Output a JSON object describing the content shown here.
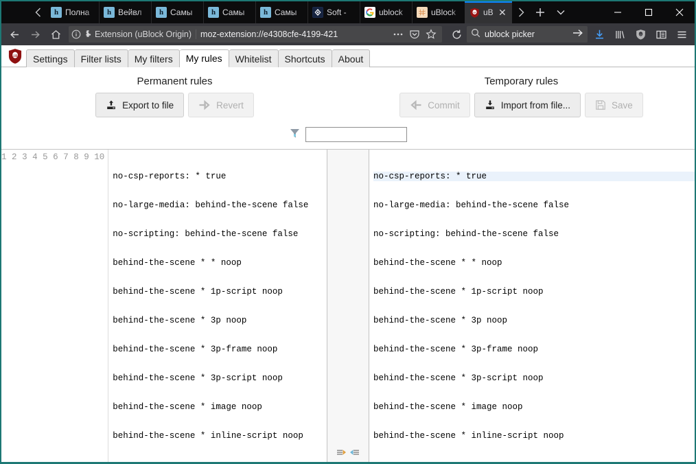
{
  "browser": {
    "tabs": [
      {
        "label": "Полна",
        "favicon": "h-icon"
      },
      {
        "label": "Вейвл",
        "favicon": "h-icon"
      },
      {
        "label": "Самы",
        "favicon": "h-icon"
      },
      {
        "label": "Самы",
        "favicon": "h-icon"
      },
      {
        "label": "Самы",
        "favicon": "h-icon"
      },
      {
        "label": "Soft - ",
        "favicon": "soft-icon"
      },
      {
        "label": "ublock",
        "favicon": "google-icon"
      },
      {
        "label": "uBlock",
        "favicon": "ublock-ball-icon"
      },
      {
        "label": "uB",
        "favicon": "ublock-shield-icon",
        "active": true
      }
    ],
    "new_tab_label": "+",
    "tab_list_menu_label": "⌄",
    "scroll_back_label": "‹",
    "scroll_forward_label": "›",
    "window_controls": {
      "minimize": "—",
      "maximize": "□",
      "close": "✕"
    },
    "nav": {
      "back": "←",
      "forward": "→",
      "home": "⌂",
      "reload": "⟳"
    },
    "urlbar": {
      "identity_label": "Extension (uBlock Origin)",
      "url": "moz-extension://e4308cfe-4199-421",
      "page_actions_label": "•••",
      "pocket_label": "pocket-icon",
      "bookmark_label": "star-icon"
    },
    "searchbar": {
      "value": "ublock picker",
      "go_label": "→",
      "search_icon": "search-icon"
    },
    "toolbar_icons": [
      "downloads-icon",
      "library-icon",
      "ublock-shield-icon",
      "sidebar-icon",
      "menu-icon"
    ]
  },
  "ublock": {
    "logo": "ublock-shield-logo",
    "tabs": [
      {
        "label": "Settings",
        "active": false
      },
      {
        "label": "Filter lists",
        "active": false
      },
      {
        "label": "My filters",
        "active": false
      },
      {
        "label": "My rules",
        "active": true
      },
      {
        "label": "Whitelist",
        "active": false
      },
      {
        "label": "Shortcuts",
        "active": false
      },
      {
        "label": "About",
        "active": false
      }
    ],
    "permanent": {
      "title": "Permanent rules",
      "buttons": [
        {
          "label": "Export to file",
          "icon": "export-upload-icon",
          "disabled": false
        },
        {
          "label": "Revert",
          "icon": "revert-arrow-icon",
          "disabled": true
        }
      ]
    },
    "temporary": {
      "title": "Temporary rules",
      "buttons": [
        {
          "label": "Commit",
          "icon": "commit-arrow-icon",
          "disabled": true
        },
        {
          "label": "Import from file...",
          "icon": "import-download-icon",
          "disabled": false
        },
        {
          "label": "Save",
          "icon": "save-disk-icon",
          "disabled": true
        }
      ]
    },
    "filter": {
      "icon": "funnel-icon",
      "value": "",
      "placeholder": ""
    },
    "permanent_rules": [
      "no-csp-reports: * true",
      "no-large-media: behind-the-scene false",
      "no-scripting: behind-the-scene false",
      "behind-the-scene * * noop",
      "behind-the-scene * 1p-script noop",
      "behind-the-scene * 3p noop",
      "behind-the-scene * 3p-frame noop",
      "behind-the-scene * 3p-script noop",
      "behind-the-scene * image noop",
      "behind-the-scene * inline-script noop"
    ],
    "temporary_rules": [
      "no-csp-reports: * true",
      "no-large-media: behind-the-scene false",
      "no-scripting: behind-the-scene false",
      "behind-the-scene * * noop",
      "behind-the-scene * 1p-script noop",
      "behind-the-scene * 3p noop",
      "behind-the-scene * 3p-frame noop",
      "behind-the-scene * 3p-script noop",
      "behind-the-scene * image noop",
      "behind-the-scene * inline-script noop"
    ],
    "line_numbers": [
      "1",
      "2",
      "3",
      "4",
      "5",
      "6",
      "7",
      "8",
      "9",
      "10"
    ],
    "divider_buttons": [
      {
        "icon": "copy-right-icon"
      },
      {
        "icon": "copy-left-icon"
      }
    ]
  },
  "colors": {
    "window_accent": "#1d7874",
    "tab_active_indicator": "#0a84ff",
    "ublock_red": "#8f1010",
    "chrome_dark": "#0c0c0d",
    "navbar": "#38383d",
    "cursor_line": "#eaf2fb"
  }
}
